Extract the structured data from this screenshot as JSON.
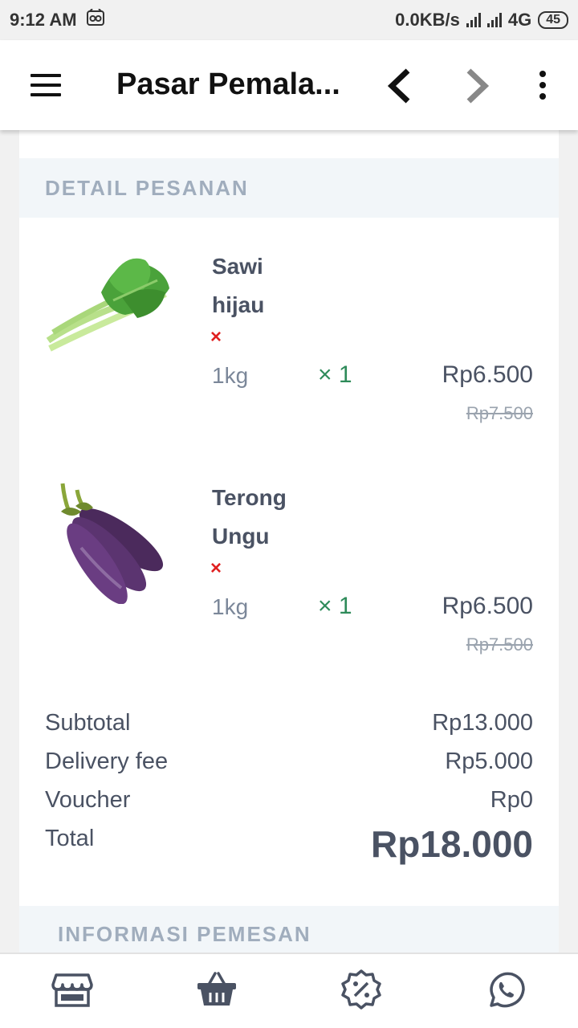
{
  "status_bar": {
    "time": "9:12 AM",
    "network_speed": "0.0KB/s",
    "network_type": "4G",
    "battery": "45"
  },
  "app_bar": {
    "title": "Pasar Pemala...",
    "icons": [
      "menu-icon",
      "chevron-left-icon",
      "chevron-right-icon",
      "more-vert-icon"
    ]
  },
  "order": {
    "section_title": "DETAIL PESANAN",
    "items": [
      {
        "name": "Sawi hijau",
        "remove_symbol": "×",
        "unit": "1kg",
        "quantity": "× 1",
        "price": "Rp6.500",
        "original_price": "Rp7.500",
        "image": "mustard-greens"
      },
      {
        "name": "Terong Ungu",
        "remove_symbol": "×",
        "unit": "1kg",
        "quantity": "× 1",
        "price": "Rp6.500",
        "original_price": "Rp7.500",
        "image": "purple-eggplant"
      }
    ]
  },
  "summary": {
    "subtotal_label": "Subtotal",
    "subtotal_value": "Rp13.000",
    "delivery_label": "Delivery fee",
    "delivery_value": "Rp5.000",
    "voucher_label": "Voucher",
    "voucher_value": "Rp0",
    "total_label": "Total",
    "total_value": "Rp18.000"
  },
  "customer_section_title": "INFORMASI PEMESAN",
  "bottom_nav": [
    "store-icon",
    "basket-icon",
    "discount-badge-icon",
    "whatsapp-icon"
  ],
  "colors": {
    "accent_green": "#2e8b5a",
    "remove_red": "#e02020",
    "text_dark": "#4a5263",
    "section_head_text": "#a0adbd"
  }
}
